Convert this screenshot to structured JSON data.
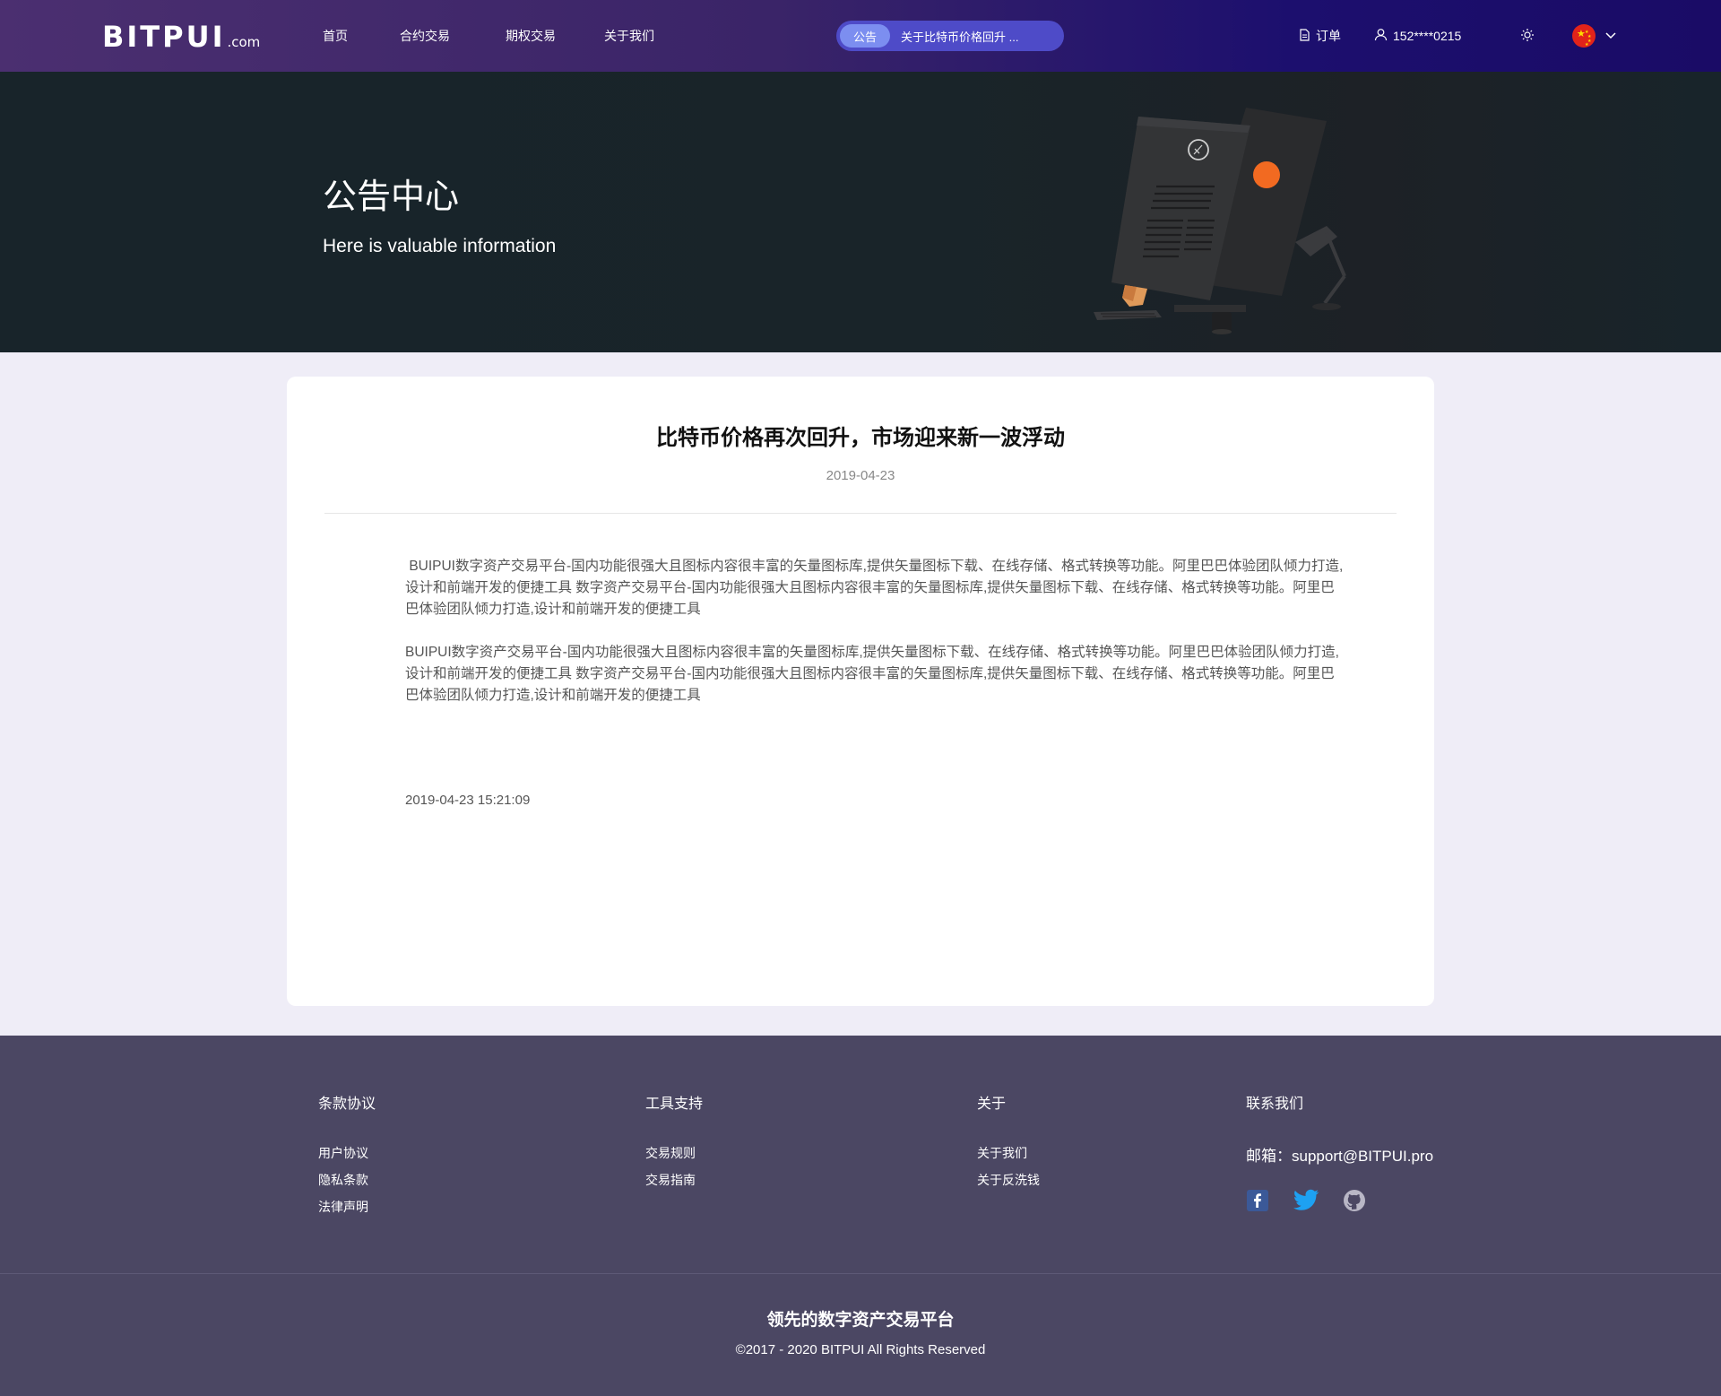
{
  "header": {
    "logo": "BITPUI",
    "logo_suffix": ".com",
    "nav": [
      "首页",
      "合约交易",
      "期权交易",
      "关于我们"
    ],
    "notice_tag": "公告",
    "notice_text": "关于比特币价格回升 ...",
    "orders_label": "订单",
    "user_label": "152****0215",
    "language_flag": "china-flag"
  },
  "hero": {
    "title": "公告中心",
    "subtitle": "Here is valuable information"
  },
  "article": {
    "title": "比特币价格再次回升，市场迎来新一波浮动",
    "date": "2019-04-23",
    "paragraphs": [
      " BUIPUI数字资产交易平台-国内功能很强大且图标内容很丰富的矢量图标库,提供矢量图标下载、在线存储、格式转换等功能。阿里巴巴体验团队倾力打造,设计和前端开发的便捷工具 数字资产交易平台-国内功能很强大且图标内容很丰富的矢量图标库,提供矢量图标下载、在线存储、格式转换等功能。阿里巴巴体验团队倾力打造,设计和前端开发的便捷工具",
      "BUIPUI数字资产交易平台-国内功能很强大且图标内容很丰富的矢量图标库,提供矢量图标下载、在线存储、格式转换等功能。阿里巴巴体验团队倾力打造,设计和前端开发的便捷工具 数字资产交易平台-国内功能很强大且图标内容很丰富的矢量图标库,提供矢量图标下载、在线存储、格式转换等功能。阿里巴巴体验团队倾力打造,设计和前端开发的便捷工具"
    ],
    "timestamp": "2019-04-23 15:21:09"
  },
  "footer": {
    "col1": {
      "title": "条款协议",
      "links": [
        "用户协议",
        "隐私条款",
        "法律声明"
      ]
    },
    "col2": {
      "title": "工具支持",
      "links": [
        "交易规则",
        "交易指南"
      ]
    },
    "col3": {
      "title": "关于",
      "links": [
        "关于我们",
        "关于反洗钱"
      ]
    },
    "col4": {
      "title": "联系我们",
      "email": "邮箱：support@BITPUI.pro"
    },
    "socials": [
      "facebook-icon",
      "twitter-icon",
      "github-icon"
    ],
    "slogan": "领先的数字资产交易平台",
    "copyright": "©2017 - 2020 BITPUI All Rights Reserved"
  },
  "colors": {
    "header_left": "#4b2f70",
    "header_right": "#1a0b66",
    "hero_bg": "#18242a",
    "page_bg": "#efedf7",
    "footer_bg": "#4b4763",
    "notice_pill": "#4e4bc8"
  }
}
